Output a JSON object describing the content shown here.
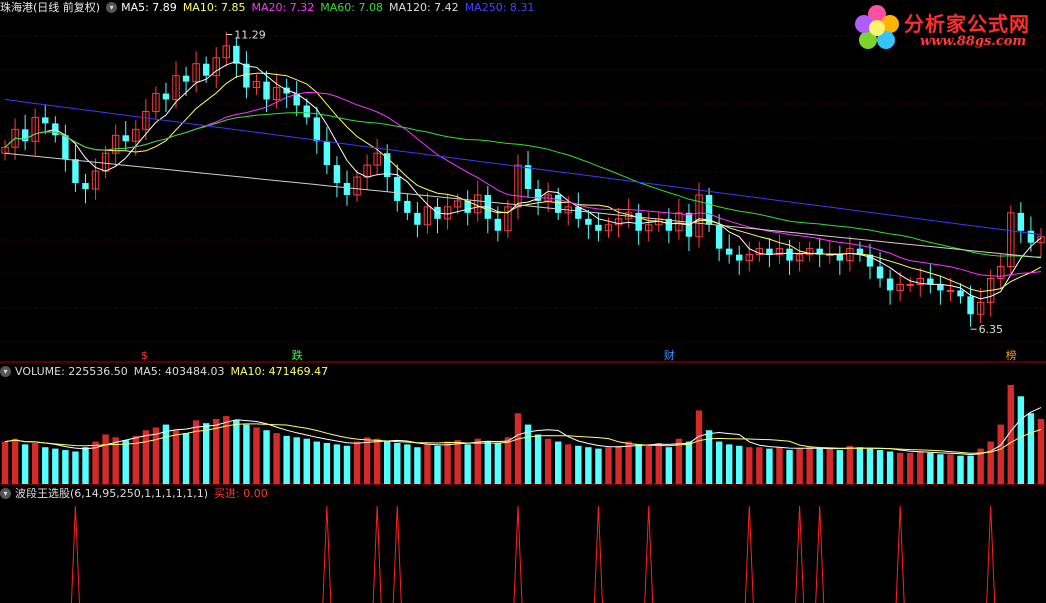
{
  "header_main": {
    "title": "珠海港(日线 前复权)",
    "items": [
      {
        "label": "MA5: 7.89",
        "color": "#ffffff"
      },
      {
        "label": "MA10: 7.85",
        "color": "#ffff66"
      },
      {
        "label": "MA20: 7.32",
        "color": "#ff33ff"
      },
      {
        "label": "MA60: 7.08",
        "color": "#33dd33"
      },
      {
        "label": "MA120: 7.42",
        "color": "#dddddd"
      },
      {
        "label": "MA250: 8.31",
        "color": "#4444ff"
      }
    ]
  },
  "header_volume": {
    "items": [
      {
        "label": "VOLUME: 225536.50",
        "color": "#dddddd"
      },
      {
        "label": "MA5: 403484.03",
        "color": "#dddddd"
      },
      {
        "label": "MA10: 471469.47",
        "color": "#ffff66"
      }
    ]
  },
  "header_indicator": {
    "name": "波段王选股(6,14,95,250,1,1,1,1,1,1)",
    "signal_label": "买进: 0.00",
    "signal_color": "#ff3333"
  },
  "logo": {
    "title": "分析家公式网",
    "url_text": "www.88gs.com"
  },
  "chart_data": {
    "type": "candlestick",
    "series_names": [
      "MA5",
      "MA10",
      "MA20",
      "MA60",
      "MA120",
      "MA250"
    ],
    "price_range": [
      5.8,
      11.6
    ],
    "high_label": "11.29",
    "low_label": "6.35",
    "markers": [
      {
        "text": "$",
        "color": "#ff3333"
      },
      {
        "text": "跌",
        "color": "#33ff33"
      },
      {
        "text": "财",
        "color": "#3399ff"
      },
      {
        "text": "榜",
        "color": "#ff9900"
      }
    ],
    "close": [
      9.4,
      9.7,
      9.5,
      9.9,
      9.8,
      9.6,
      9.2,
      8.8,
      8.7,
      9.0,
      9.3,
      9.6,
      9.5,
      9.7,
      10.0,
      10.3,
      10.2,
      10.6,
      10.5,
      10.8,
      10.6,
      10.9,
      11.1,
      10.8,
      10.4,
      10.5,
      10.2,
      10.4,
      10.3,
      10.1,
      9.9,
      9.5,
      9.1,
      8.8,
      8.6,
      8.9,
      9.1,
      9.3,
      8.9,
      8.5,
      8.3,
      8.1,
      8.4,
      8.2,
      8.4,
      8.5,
      8.3,
      8.6,
      8.2,
      8.0,
      8.4,
      9.1,
      8.7,
      8.5,
      8.6,
      8.3,
      8.4,
      8.2,
      8.1,
      8.0,
      8.1,
      8.2,
      8.3,
      8.0,
      8.1,
      8.2,
      8.0,
      8.3,
      7.9,
      8.6,
      8.1,
      7.7,
      7.6,
      7.5,
      7.6,
      7.7,
      7.6,
      7.7,
      7.5,
      7.6,
      7.7,
      7.6,
      7.6,
      7.5,
      7.7,
      7.6,
      7.4,
      7.2,
      7.0,
      7.1,
      7.1,
      7.2,
      7.1,
      7.0,
      7.0,
      6.9,
      6.6,
      6.8,
      7.2,
      7.4,
      8.3,
      8.0,
      7.8,
      7.9
    ],
    "volume": [
      300,
      320,
      280,
      290,
      260,
      250,
      240,
      230,
      260,
      300,
      350,
      330,
      310,
      340,
      380,
      400,
      420,
      380,
      360,
      450,
      430,
      460,
      480,
      450,
      420,
      400,
      380,
      360,
      340,
      330,
      320,
      300,
      290,
      280,
      270,
      300,
      330,
      320,
      300,
      290,
      280,
      260,
      280,
      270,
      300,
      310,
      280,
      320,
      300,
      290,
      330,
      500,
      420,
      350,
      320,
      300,
      280,
      270,
      260,
      250,
      260,
      270,
      300,
      280,
      270,
      290,
      260,
      320,
      300,
      520,
      380,
      300,
      280,
      270,
      260,
      260,
      250,
      260,
      240,
      250,
      260,
      250,
      250,
      240,
      270,
      260,
      250,
      240,
      230,
      220,
      220,
      230,
      220,
      210,
      210,
      200,
      200,
      250,
      300,
      420,
      700,
      620,
      500,
      460
    ]
  }
}
